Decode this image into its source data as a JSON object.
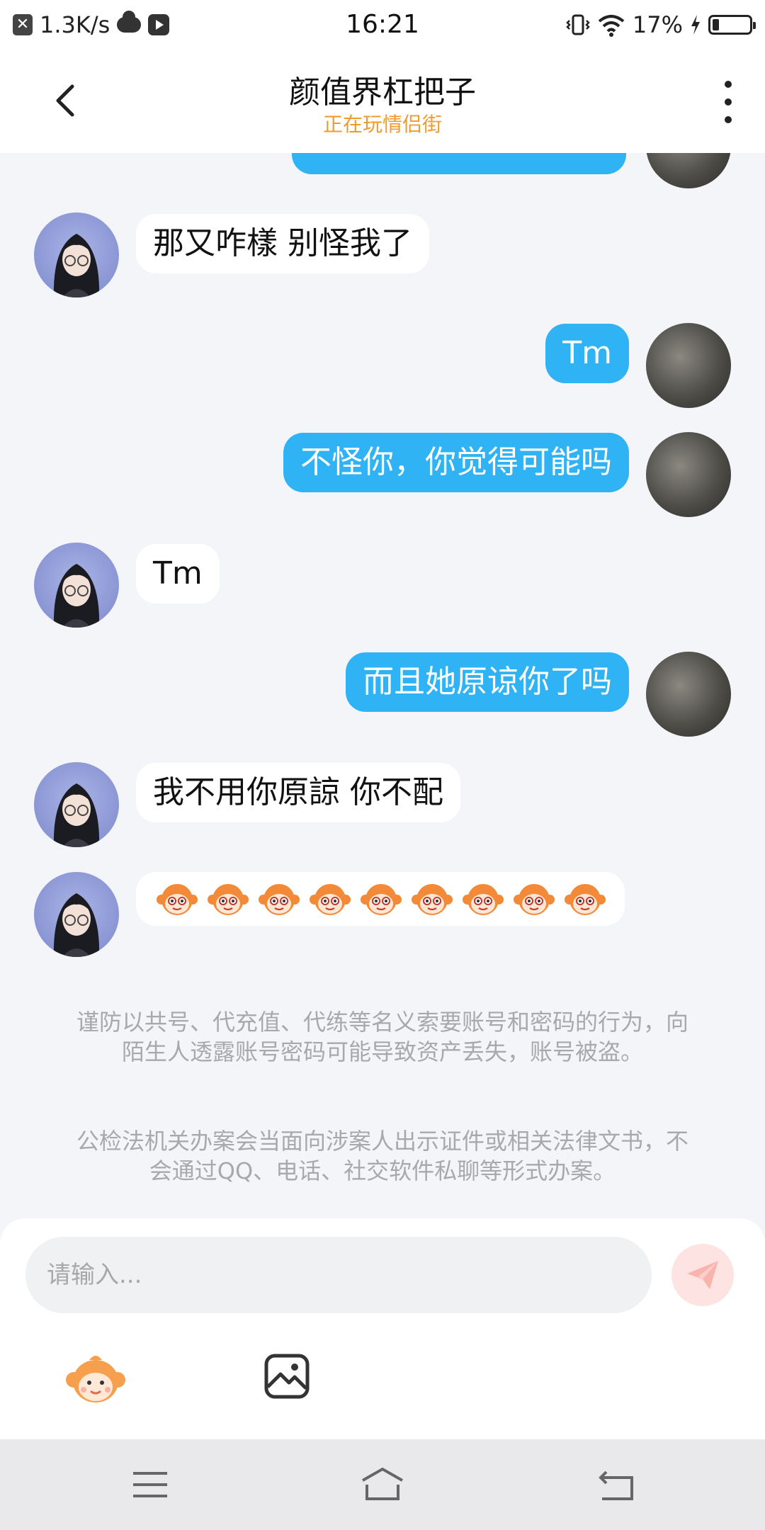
{
  "status_bar": {
    "speed": "1.3K/s",
    "time": "16:21",
    "battery": "17%",
    "battery_level": 0.17,
    "icons": [
      "close-box-icon",
      "cloud-icon",
      "play-icon",
      "vibrate-icon",
      "wifi-icon",
      "charging-icon",
      "battery-icon"
    ]
  },
  "header": {
    "title": "颜值界杠把子",
    "subtitle": "正在玩情侣街"
  },
  "messages": [
    {
      "side": "in",
      "text": "那又咋樣 别怪我了"
    },
    {
      "side": "out",
      "text": "Tm"
    },
    {
      "side": "out",
      "text": "不怪你，你觉得可能吗"
    },
    {
      "side": "in",
      "text": "Tm"
    },
    {
      "side": "out",
      "text": "而且她原谅你了吗"
    },
    {
      "side": "in",
      "text": "我不用你原諒 你不配"
    },
    {
      "side": "in",
      "emoji": "monkey-emoji",
      "count": 9
    }
  ],
  "notices": [
    "谨防以共号、代充值、代练等名义索要账号和密码的行为，向陌生人透露账号密码可能导致资产丢失，账号被盗。",
    "公检法机关办案会当面向涉案人出示证件或相关法律文书，不会通过QQ、电话、社交软件私聊等形式办案。"
  ],
  "input": {
    "placeholder": "请输入..."
  },
  "colors": {
    "accent": "#2fb3f5",
    "subtitle": "#f39a2c",
    "send_button": "#fde3e1"
  }
}
